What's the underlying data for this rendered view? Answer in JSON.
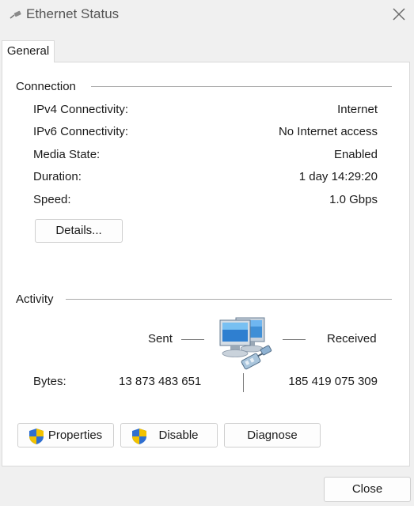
{
  "window": {
    "title": "Ethernet Status"
  },
  "tabs": [
    {
      "label": "General"
    }
  ],
  "connection": {
    "heading": "Connection",
    "rows": [
      {
        "label": "IPv4 Connectivity:",
        "value": "Internet"
      },
      {
        "label": "IPv6 Connectivity:",
        "value": "No Internet access"
      },
      {
        "label": "Media State:",
        "value": "Enabled"
      },
      {
        "label": "Duration:",
        "value": "1 day 14:29:20"
      },
      {
        "label": "Speed:",
        "value": "1.0 Gbps"
      }
    ],
    "details_button": "Details..."
  },
  "activity": {
    "heading": "Activity",
    "sent_label": "Sent",
    "received_label": "Received",
    "bytes_label": "Bytes:",
    "bytes_sent": "13 873 483 651",
    "bytes_received": "185 419 075 309"
  },
  "buttons": {
    "properties": "Properties",
    "disable": "Disable",
    "diagnose": "Diagnose",
    "close": "Close"
  },
  "icons": {
    "title": "network-cable-icon",
    "activity": "network-computers-icon",
    "shield": "uac-shield-icon",
    "close": "close-icon"
  }
}
